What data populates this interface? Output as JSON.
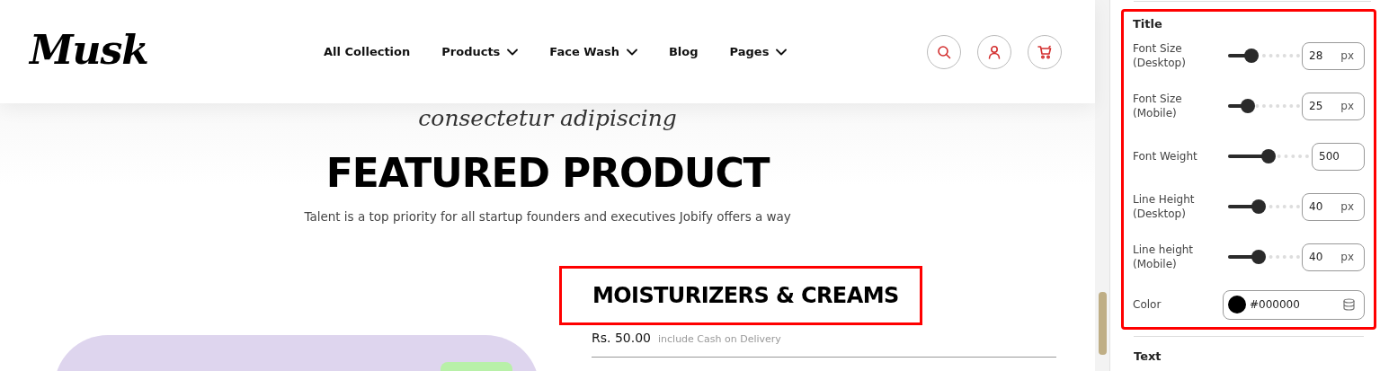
{
  "header": {
    "logo": "Musk",
    "nav": [
      {
        "label": "All Collection",
        "dropdown": false
      },
      {
        "label": "Products",
        "dropdown": true
      },
      {
        "label": "Face Wash",
        "dropdown": true
      },
      {
        "label": "Blog",
        "dropdown": false
      },
      {
        "label": "Pages",
        "dropdown": true
      }
    ],
    "actions": [
      {
        "kind": "search"
      },
      {
        "kind": "account"
      },
      {
        "kind": "cart"
      }
    ]
  },
  "hero": {
    "script_text": "consectetur adipiscing",
    "title": "FEATURED PRODUCT",
    "subtitle": "Talent is a top priority for all startup founders and executives Jobify offers a way"
  },
  "product": {
    "name": "MOISTURIZERS & CREAMS",
    "highlighted": true,
    "price": "Rs. 50.00",
    "price_note": "include Cash on Delivery"
  },
  "settings": {
    "section": "Title",
    "highlighted": true,
    "controls": [
      {
        "kind": "slider",
        "label": "Font Size (Desktop)",
        "value": "28",
        "unit": "px",
        "level": 0.33
      },
      {
        "kind": "slider",
        "label": "Font Size (Mobile)",
        "value": "25",
        "unit": "px",
        "level": 0.28
      },
      {
        "kind": "slider",
        "label": "Font Weight",
        "value": "500",
        "level": 0.5
      },
      {
        "kind": "slider",
        "label": "Line Height (Desktop)",
        "value": "40",
        "unit": "px",
        "level": 0.43
      },
      {
        "kind": "slider",
        "label": "Line height (Mobile)",
        "value": "40",
        "unit": "px",
        "level": 0.43
      },
      {
        "kind": "color",
        "label": "Color",
        "value": "#000000",
        "color": "#000000"
      }
    ],
    "next_section": "Text"
  }
}
